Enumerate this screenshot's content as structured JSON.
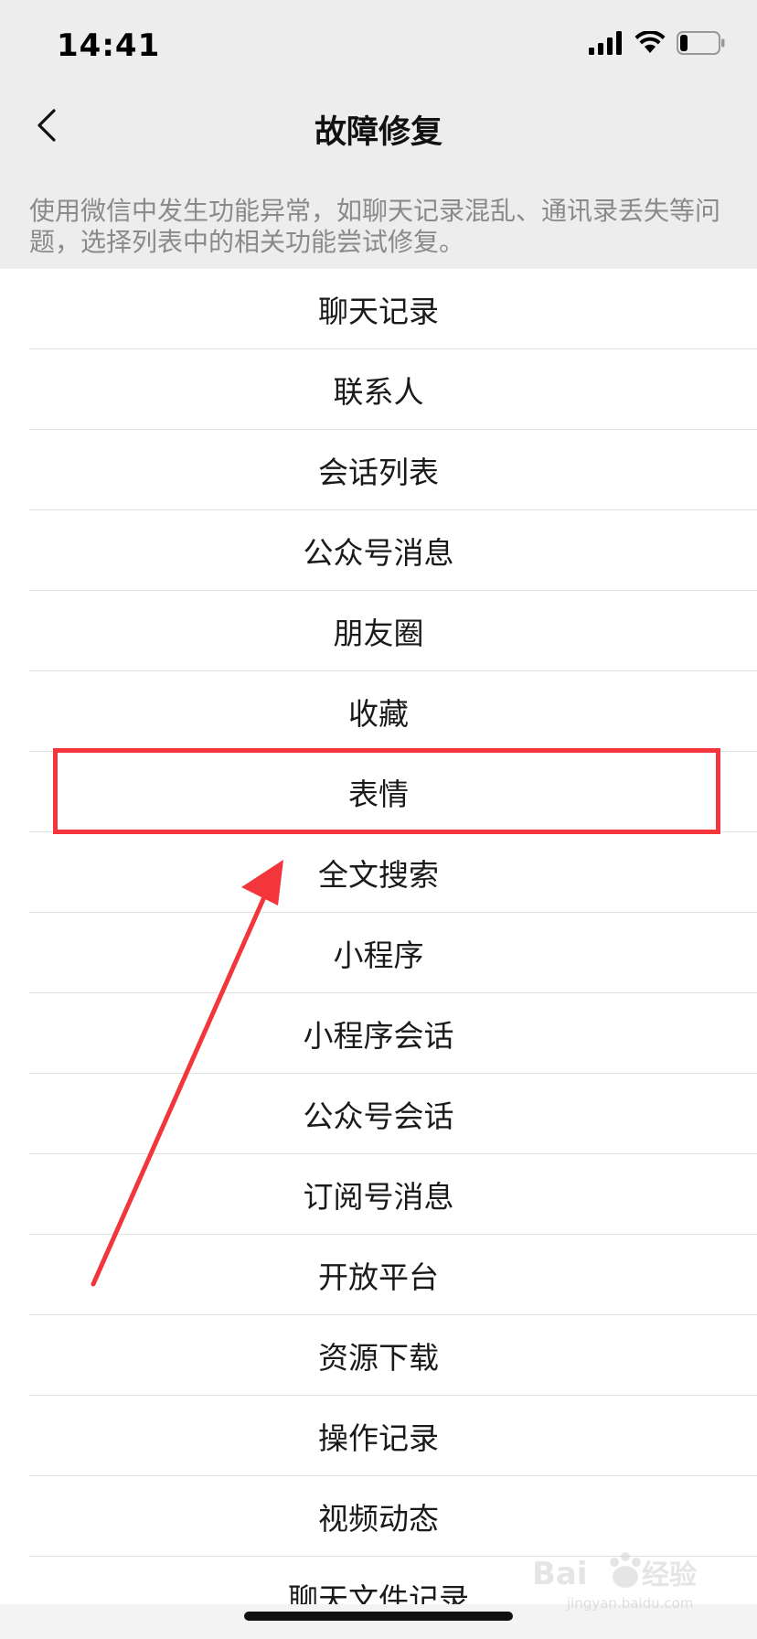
{
  "status_bar": {
    "time": "14:41",
    "signal_icon": "cellular-signal-icon",
    "wifi_icon": "wifi-icon",
    "battery_icon": "battery-icon",
    "battery_level": 0.2
  },
  "nav": {
    "title": "故障修复",
    "back_icon": "chevron-left-icon"
  },
  "description": "使用微信中发生功能异常，如聊天记录混乱、通讯录丢失等问题，选择列表中的相关功能尝试修复。",
  "list": {
    "items": [
      {
        "label": "聊天记录"
      },
      {
        "label": "联系人"
      },
      {
        "label": "会话列表"
      },
      {
        "label": "公众号消息"
      },
      {
        "label": "朋友圈"
      },
      {
        "label": "收藏"
      },
      {
        "label": "表情"
      },
      {
        "label": "全文搜索"
      },
      {
        "label": "小程序"
      },
      {
        "label": "小程序会话"
      },
      {
        "label": "公众号会话"
      },
      {
        "label": "订阅号消息"
      },
      {
        "label": "开放平台"
      },
      {
        "label": "资源下载"
      },
      {
        "label": "操作记录"
      },
      {
        "label": "视频动态"
      },
      {
        "label": "聊天文件记录"
      }
    ],
    "highlighted_index": 6
  },
  "annotation": {
    "color": "#f2363b"
  },
  "watermark": {
    "brand": "Bai du 经验",
    "url": "jingyan.baidu.com"
  }
}
